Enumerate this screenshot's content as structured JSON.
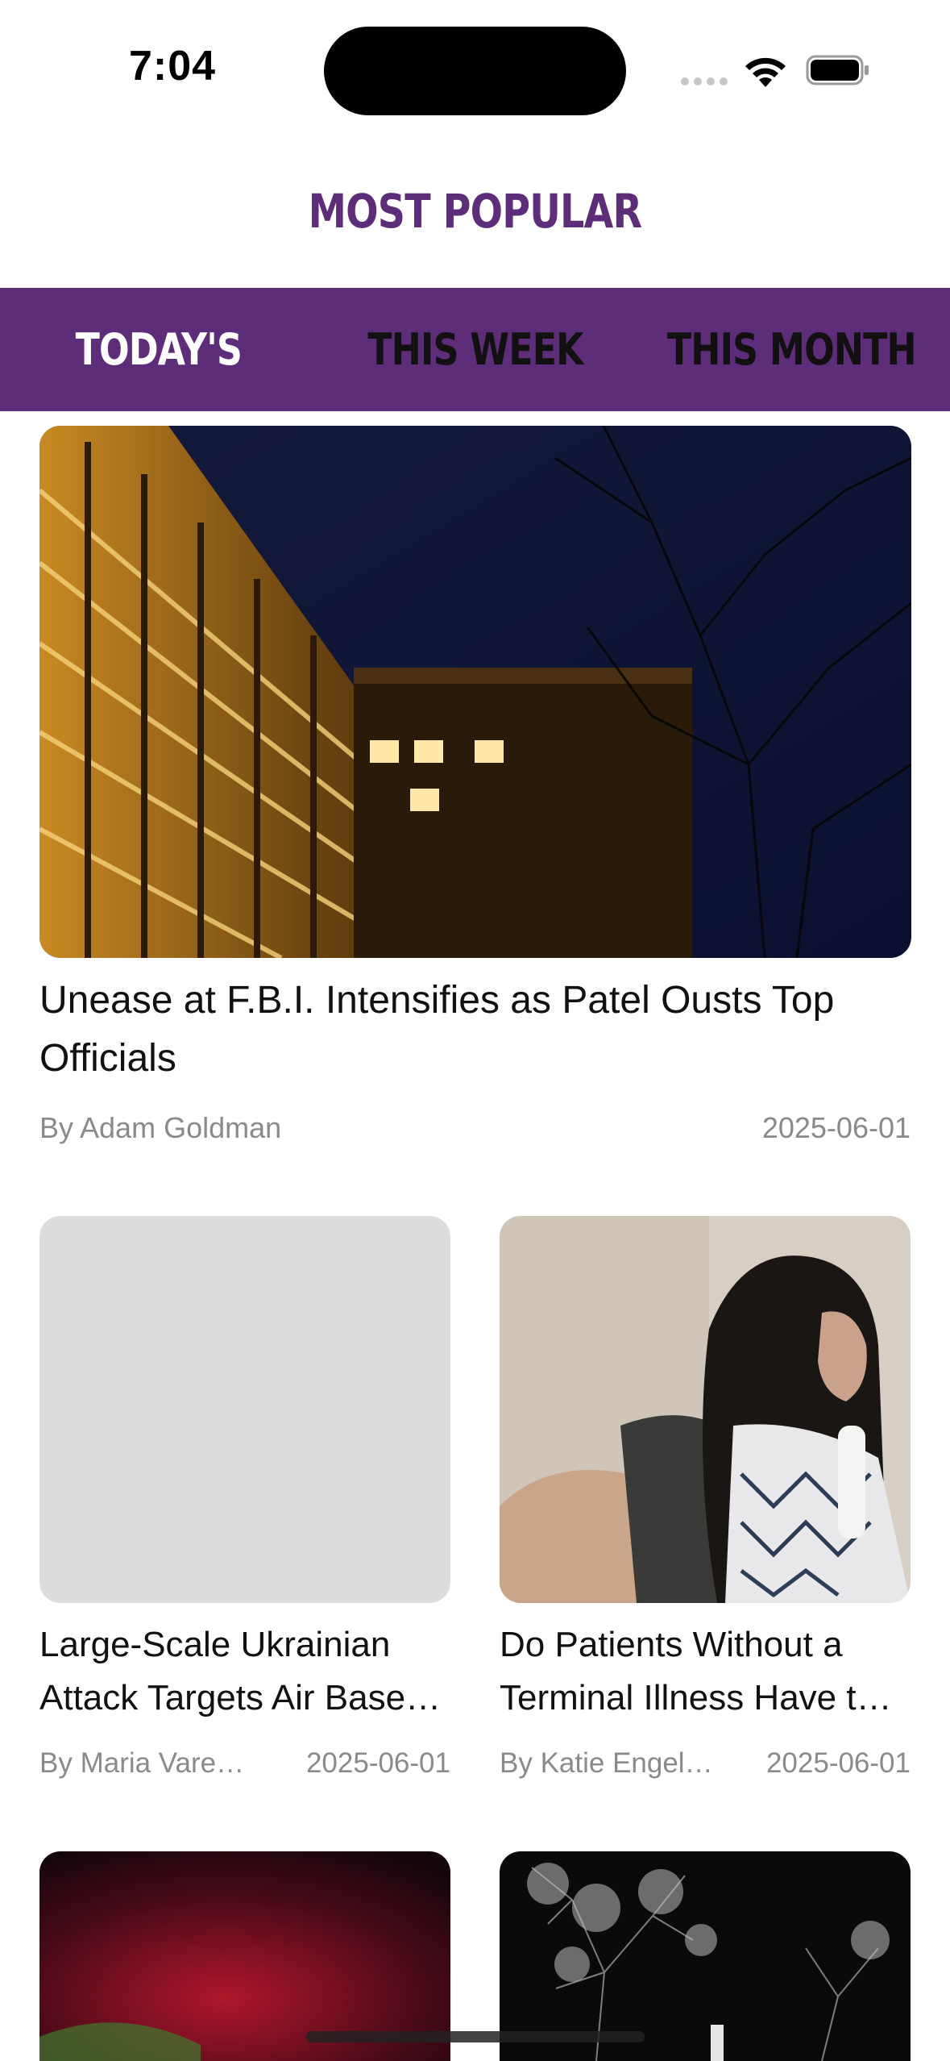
{
  "status_bar": {
    "time": "7:04"
  },
  "header": {
    "title": "MOST POPULAR"
  },
  "tabs": [
    {
      "label": "TODAY'S",
      "active": true
    },
    {
      "label": "THIS WEEK",
      "active": false
    },
    {
      "label": "THIS MONTH",
      "active": false
    }
  ],
  "hero": {
    "title": "Unease at F.B.I. Intensifies as Patel Ousts Top Officials",
    "author": "By Adam Goldman",
    "date": "2025-06-01"
  },
  "articles": [
    {
      "title": "Large-Scale Ukrainian Attack Targets Air Bases in Russia",
      "author": "By Maria Varenikova",
      "date": "2025-06-01"
    },
    {
      "title": "Do Patients Without a Terminal Illness Have the Right to Die?",
      "author": "By Katie Engelhart",
      "date": "2025-06-01"
    }
  ],
  "colors": {
    "brand": "#5e2d79",
    "meta": "#8a8a8e",
    "placeholder": "#dcdcdf"
  },
  "icons": [
    "cellular-signal-icon",
    "wifi-icon",
    "battery-icon"
  ]
}
